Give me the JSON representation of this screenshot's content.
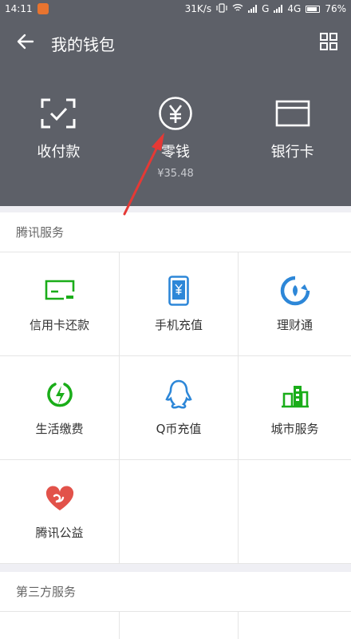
{
  "status_bar": {
    "time": "14:11",
    "net_speed": "31K/s",
    "net_g": "G",
    "net_4g": "4G",
    "battery": "76%"
  },
  "header": {
    "title": "我的钱包",
    "back_icon": "arrow-left-icon",
    "more_icon": "grid-icon",
    "actions": [
      {
        "label": "收付款",
        "icon": "scan-check-icon"
      },
      {
        "label": "零钱",
        "sub": "¥35.48",
        "icon": "yuan-circle-icon"
      },
      {
        "label": "银行卡",
        "icon": "card-icon"
      }
    ]
  },
  "tencent_services": {
    "title": "腾讯服务",
    "items": [
      {
        "label": "信用卡还款",
        "icon": "credit-card-repay-icon"
      },
      {
        "label": "手机充值",
        "icon": "phone-yuan-icon"
      },
      {
        "label": "理财通",
        "icon": "licaitong-icon"
      },
      {
        "label": "生活缴费",
        "icon": "lightning-icon"
      },
      {
        "label": "Q币充值",
        "icon": "qq-penguin-icon"
      },
      {
        "label": "城市服务",
        "icon": "city-building-icon"
      },
      {
        "label": "腾讯公益",
        "icon": "heart-charity-icon"
      }
    ]
  },
  "third_party": {
    "title": "第三方服务"
  },
  "colors": {
    "header_bg": "#5d6068",
    "icon_green": "#1aad19",
    "icon_blue": "#2d87d8",
    "icon_red": "#e2524a",
    "annotation_red": "#e53935"
  }
}
